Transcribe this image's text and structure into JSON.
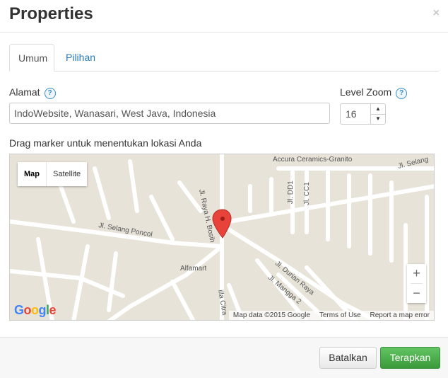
{
  "dialog": {
    "title": "Properties",
    "close_glyph": "×"
  },
  "tabs": [
    {
      "label": "Umum",
      "active": true
    },
    {
      "label": "Pilihan",
      "active": false
    }
  ],
  "address": {
    "label": "Alamat",
    "help": "?",
    "value": "IndoWebsite, Wanasari, West Java, Indonesia"
  },
  "zoom": {
    "label": "Level Zoom",
    "help": "?",
    "value": "16",
    "up": "▲",
    "down": "▼"
  },
  "map": {
    "instruction": "Drag marker untuk menentukan lokasi Anda",
    "type_map": "Map",
    "type_satellite": "Satellite",
    "zoom_in": "+",
    "zoom_out": "−",
    "attribution": "Map data ©2015 Google",
    "terms": "Terms of Use",
    "report": "Report a map error",
    "places": {
      "accura": "Accura Ceramics-Granito",
      "alfamart": "Alfamart",
      "selang_top": "Jl. Selang",
      "selang_poncol": "Jl. Selang Poncol",
      "raya_bosih": "Jl. Raya H. Bosih",
      "durian": "Jl. Durian Raya",
      "mangga": "Jl. Mangga 2",
      "dd1": "Jl. DD1",
      "cc1": "Jl. CC1",
      "citra": "illa Citra"
    },
    "logo": {
      "G": "G",
      "o1": "o",
      "o2": "o",
      "g": "g",
      "l": "l",
      "e": "e"
    }
  },
  "footer": {
    "cancel": "Batalkan",
    "apply": "Terapkan"
  },
  "colors": {
    "accent": "#3a9a3a",
    "link": "#2a7ab8",
    "marker": "#e8433a"
  }
}
